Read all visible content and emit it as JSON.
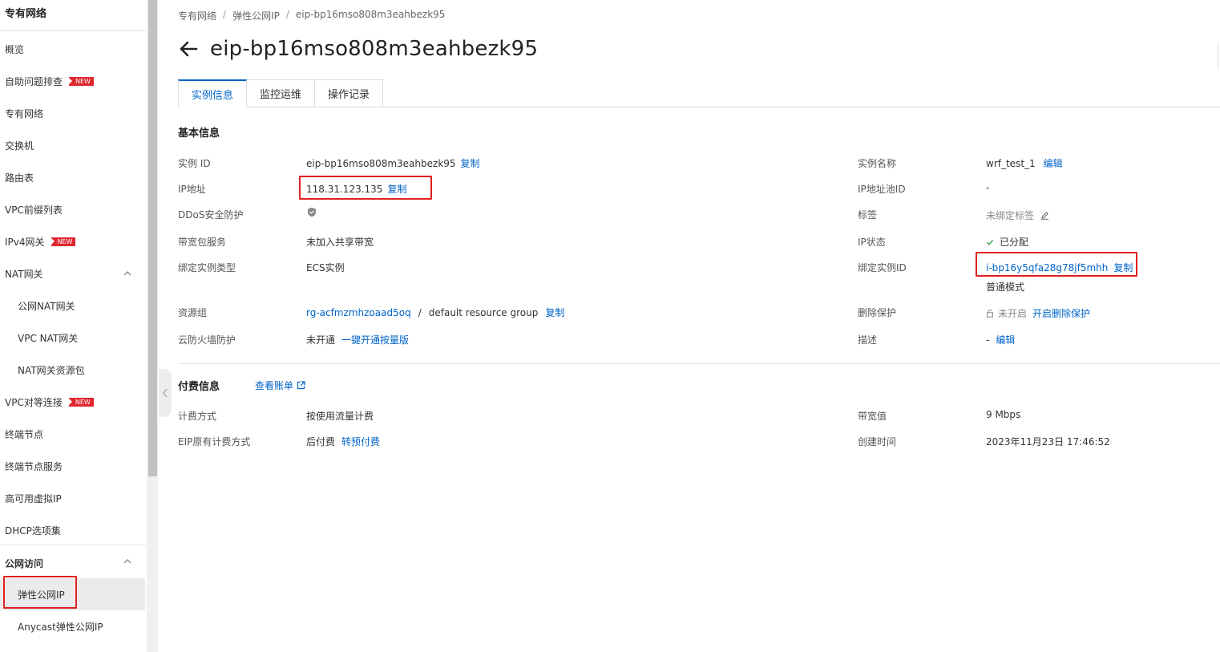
{
  "sidebar": {
    "title": "专有网络",
    "items": [
      {
        "label": "概览"
      },
      {
        "label": "自助问题排查",
        "badge": "NEW"
      },
      {
        "label": "专有网络"
      },
      {
        "label": "交换机"
      },
      {
        "label": "路由表"
      },
      {
        "label": "VPC前缀列表"
      },
      {
        "label": "IPv4网关",
        "badge": "NEW"
      },
      {
        "label": "NAT网关"
      },
      {
        "label": "公网NAT网关"
      },
      {
        "label": "VPC NAT网关"
      },
      {
        "label": "NAT网关资源包"
      },
      {
        "label": "VPC对等连接",
        "badge": "NEW"
      },
      {
        "label": "终端节点"
      },
      {
        "label": "终端节点服务"
      },
      {
        "label": "高可用虚拟IP"
      },
      {
        "label": "DHCP选项集"
      },
      {
        "label": "公网访问"
      },
      {
        "label": "弹性公网IP"
      },
      {
        "label": "Anycast弹性公网IP"
      }
    ]
  },
  "breadcrumb": [
    "专有网络",
    "弹性公网IP",
    "eip-bp16mso808m3eahbezk95"
  ],
  "page_title": "eip-bp16mso808m3eahbezk95",
  "tabs": [
    "实例信息",
    "监控运维",
    "操作记录"
  ],
  "basic": {
    "section_title": "基本信息",
    "copy": "复制",
    "edit": "编辑",
    "instance_id_label": "实例 ID",
    "instance_id": "eip-bp16mso808m3eahbezk95",
    "ip_label": "IP地址",
    "ip": "118.31.123.135",
    "ddos_label": "DDoS安全防护",
    "bandwidth_pkg_label": "带宽包服务",
    "bandwidth_pkg": "未加入共享带宽",
    "bind_type_label": "绑定实例类型",
    "bind_type": "ECS实例",
    "rg_label": "资源组",
    "rg_id": "rg-acfmzmhzoaad5oq",
    "rg_sep": "/",
    "rg_name": "default resource group",
    "firewall_label": "云防火墙防护",
    "firewall_status": "未开通",
    "firewall_action": "一键开通按量版",
    "name_label": "实例名称",
    "name": "wrf_test_1",
    "pool_label": "IP地址池ID",
    "pool": "-",
    "tag_label": "标签",
    "tag": "未绑定标签",
    "status_label": "IP状态",
    "status": "已分配",
    "bind_id_label": "绑定实例ID",
    "bind_id": "i-bp16y5qfa28g78jf5mhh",
    "bind_mode": "普通模式",
    "delete_label": "删除保护",
    "delete_status": "未开启",
    "delete_action": "开启删除保护",
    "desc_label": "描述",
    "desc": "-"
  },
  "billing": {
    "section_title": "付费信息",
    "view_bill": "查看账单",
    "method_label": "计费方式",
    "method": "按使用流量计费",
    "orig_label": "EIP原有计费方式",
    "orig": "后付费",
    "orig_action": "转预付费",
    "bw_label": "带宽值",
    "bw": "9 Mbps",
    "created_label": "创建时间",
    "created": "2023年11月23日 17:46:52"
  },
  "colors": {
    "link": "#0064c8",
    "highlight": "#e02020",
    "badge": "#e0262f",
    "success": "#1e9e3c"
  }
}
